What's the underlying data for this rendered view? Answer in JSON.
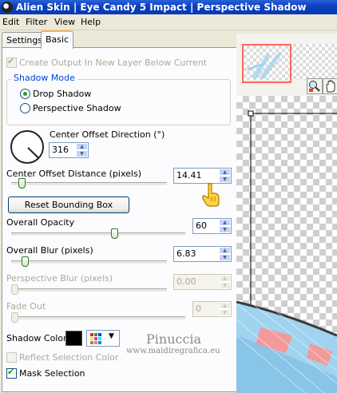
{
  "window": {
    "title": "Alien Skin | Eye Candy 5 Impact | Perspective Shadow"
  },
  "menu": [
    "Edit",
    "Filter",
    "View",
    "Help"
  ],
  "tabs": [
    {
      "label": "Settings",
      "active": false
    },
    {
      "label": "Basic",
      "active": true
    }
  ],
  "basic": {
    "create_output_label": "Create Output In New Layer Below Current",
    "create_output_checked": true,
    "shadow_mode": {
      "title": "Shadow Mode",
      "options": [
        "Drop Shadow",
        "Perspective Shadow"
      ],
      "selected": "Drop Shadow"
    },
    "center_offset_direction": {
      "label": "Center Offset Direction (°)",
      "value": "316"
    },
    "center_offset_distance": {
      "label": "Center Offset Distance (pixels)",
      "value": "14.41",
      "fraction": 0.05
    },
    "reset_button": "Reset Bounding Box",
    "overall_opacity": {
      "label": "Overall Opacity",
      "value": "60",
      "fraction": 0.6
    },
    "overall_blur": {
      "label": "Overall Blur (pixels)",
      "value": "6.83",
      "fraction": 0.07
    },
    "perspective_blur": {
      "label": "Perspective Blur (pixels)",
      "value": "0.00",
      "fraction": 0.0,
      "disabled": true
    },
    "fade_out": {
      "label": "Fade Out",
      "value": "0",
      "fraction": 0.0,
      "disabled": true
    },
    "shadow_color": {
      "label": "Shadow Color",
      "value": "#000000"
    },
    "reflect_selection_color": {
      "label": "Reflect Selection Color",
      "checked": false,
      "disabled": true
    },
    "mask_selection": {
      "label": "Mask Selection",
      "checked": true
    }
  },
  "watermark": {
    "line1": "Pinuccia",
    "line2": "www.maidiregrafica.eu"
  },
  "colors": {
    "titlebar": "#0a3fc0",
    "accent_green": "#21a121",
    "preview_blue": "#9fd3ef",
    "preview_pink": "#f29a9a"
  }
}
